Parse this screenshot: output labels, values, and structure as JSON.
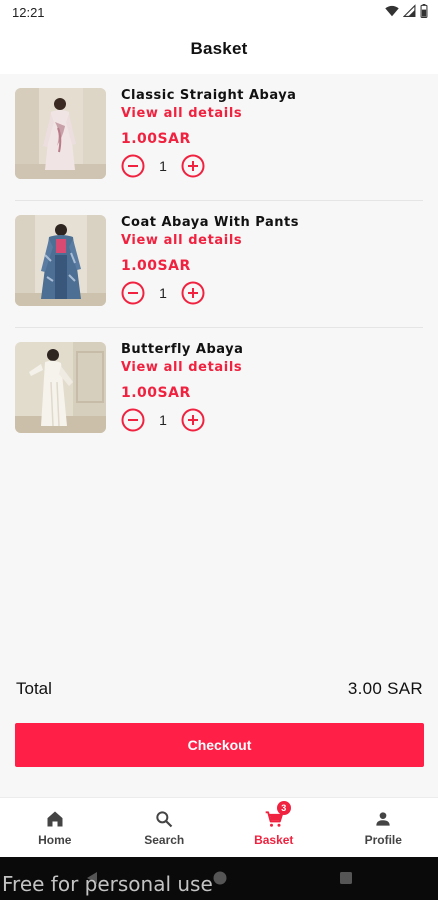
{
  "status_bar": {
    "time": "12:21"
  },
  "header": {
    "title": "Basket"
  },
  "items": [
    {
      "name": "Classic Straight Abaya",
      "details_link": "View all details",
      "price": "1.00SAR",
      "quantity": "1"
    },
    {
      "name": "Coat Abaya With Pants",
      "details_link": "View all details",
      "price": "1.00SAR",
      "quantity": "1"
    },
    {
      "name": "Butterfly Abaya",
      "details_link": "View all details",
      "price": "1.00SAR",
      "quantity": "1"
    }
  ],
  "summary": {
    "total_label": "Total",
    "total_value": "3.00 SAR"
  },
  "checkout_label": "Checkout",
  "bottom_nav": {
    "items": [
      {
        "label": "Home",
        "icon": "home-icon"
      },
      {
        "label": "Search",
        "icon": "search-icon"
      },
      {
        "label": "Basket",
        "icon": "cart-icon",
        "badge": "3",
        "active": true
      },
      {
        "label": "Profile",
        "icon": "person-icon"
      }
    ]
  },
  "watermark": "Free for personal use",
  "colors": {
    "accent": "#f0223f",
    "checkout": "#ff1f47",
    "background": "#f7f7f7"
  }
}
